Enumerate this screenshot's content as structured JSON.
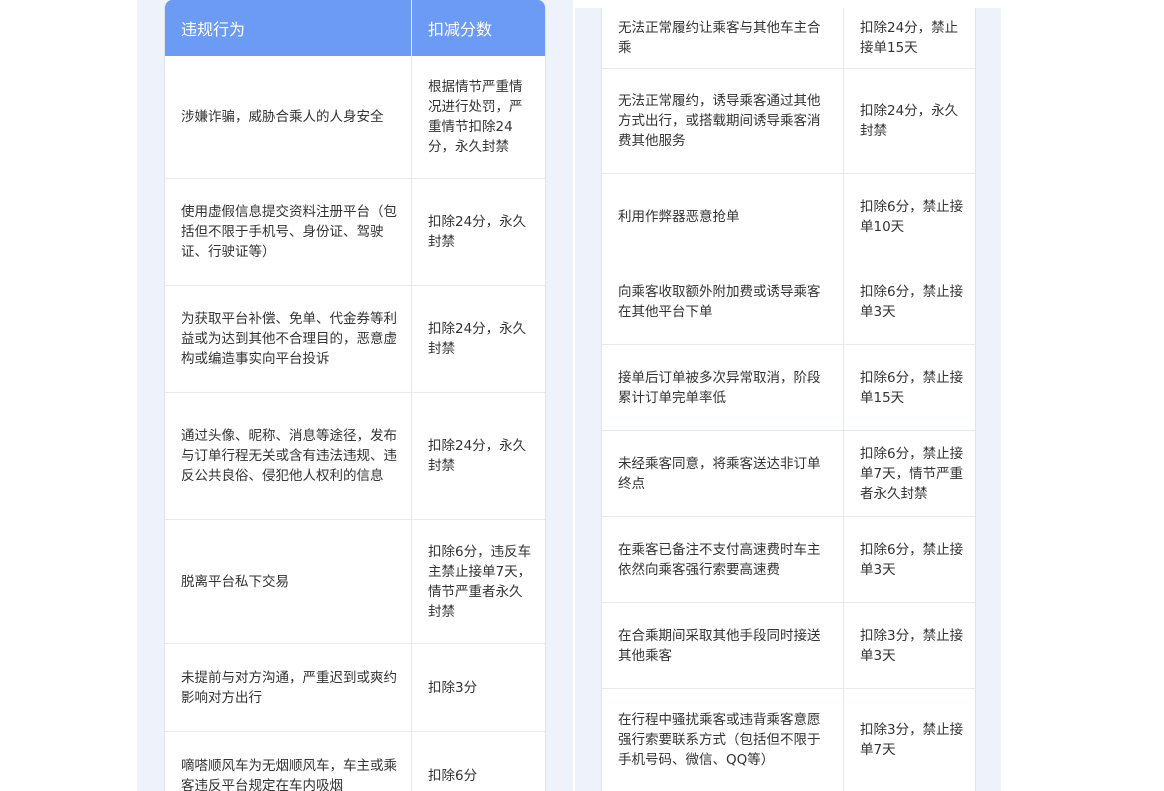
{
  "left_table": {
    "header": {
      "behavior": "违规行为",
      "deduction": "扣减分数"
    },
    "rows": [
      {
        "behavior": "涉嫌诈骗，威胁合乘人的人身安全",
        "deduction": "根据情节严重情况进行处罚，严重情节扣除24分，永久封禁"
      },
      {
        "behavior": "使用虚假信息提交资料注册平台（包括但不限于手机号、身份证、驾驶证、行驶证等）",
        "deduction": "扣除24分，永久封禁"
      },
      {
        "behavior": "为获取平台补偿、免单、代金券等利益或为达到其他不合理目的，恶意虚构或编造事实向平台投诉",
        "deduction": "扣除24分，永久封禁"
      },
      {
        "behavior": "通过头像、昵称、消息等途径，发布与订单行程无关或含有违法违规、违反公共良俗、侵犯他人权利的信息",
        "deduction": "扣除24分，永久封禁"
      },
      {
        "behavior": "脱离平台私下交易",
        "deduction": "扣除6分，违反车主禁止接单7天，情节严重者永久封禁"
      },
      {
        "behavior": "未提前与对方沟通，严重迟到或爽约影响对方出行",
        "deduction": "扣除3分"
      },
      {
        "behavior": "嘀嗒顺风车为无烟顺风车，车主或乘客违反平台规定在车内吸烟",
        "deduction": "扣除6分"
      }
    ]
  },
  "right_table": {
    "rows": [
      {
        "behavior": "无法正常履约让乘客与其他车主合乘",
        "deduction": "扣除24分，禁止接单15天"
      },
      {
        "behavior": "无法正常履约，诱导乘客通过其他方式出行，或搭载期间诱导乘客消费其他服务",
        "deduction": "扣除24分，永久封禁"
      },
      {
        "behavior": "利用作弊器恶意抢单",
        "deduction": "扣除6分，禁止接单10天"
      },
      {
        "behavior": "向乘客收取额外附加费或诱导乘客在其他平台下单",
        "deduction": "扣除6分，禁止接单3天"
      },
      {
        "behavior": "接单后订单被多次异常取消，阶段累计订单完单率低",
        "deduction": "扣除6分，禁止接单15天"
      },
      {
        "behavior": "未经乘客同意，将乘客送达非订单终点",
        "deduction": "扣除6分，禁止接单7天，情节严重者永久封禁"
      },
      {
        "behavior": "在乘客已备注不支付高速费时车主依然向乘客强行索要高速费",
        "deduction": "扣除6分，禁止接单3天"
      },
      {
        "behavior": "在合乘期间采取其他手段同时接送其他乘客",
        "deduction": "扣除3分，禁止接单3天"
      },
      {
        "behavior": "在行程中骚扰乘客或违背乘客意愿强行索要联系方式（包括但不限于手机号码、微信、QQ等）",
        "deduction": "扣除3分，禁止接单7天"
      }
    ]
  },
  "colors": {
    "header_bg": "#6b9bf4",
    "page_bg": "#eef3fb",
    "text": "#333333"
  }
}
